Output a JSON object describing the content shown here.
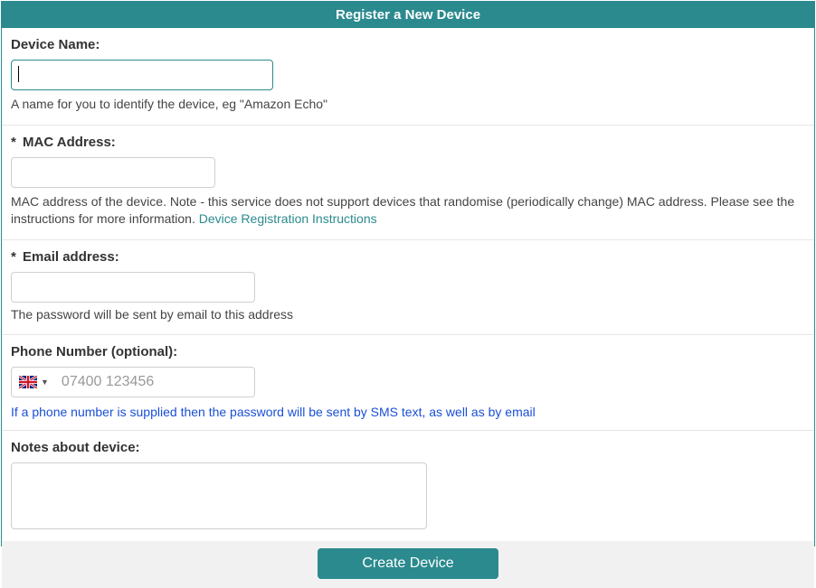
{
  "header": {
    "title": "Register a New Device"
  },
  "device_name": {
    "label": "Device Name:",
    "value": "",
    "help": "A name for you to identify the device, eg \"Amazon Echo\""
  },
  "mac": {
    "asterisk": "*",
    "label": "MAC Address:",
    "value": "",
    "help_pre": "MAC address of the device. Note - this service does not support devices that randomise (periodically change) MAC address. Please see the instructions for more information. ",
    "help_link": "Device Registration Instructions"
  },
  "email": {
    "asterisk": "*",
    "label": "Email address:",
    "value": "",
    "help": "The password will be sent by email to this address"
  },
  "phone": {
    "label": "Phone Number (optional):",
    "placeholder": "07400 123456",
    "value": "",
    "flag_name": "uk-flag",
    "help": "If a phone number is supplied then the password will be sent by SMS text, as well as by email"
  },
  "notes": {
    "label": "Notes about device:",
    "value": ""
  },
  "footer": {
    "create_label": "Create Device"
  }
}
